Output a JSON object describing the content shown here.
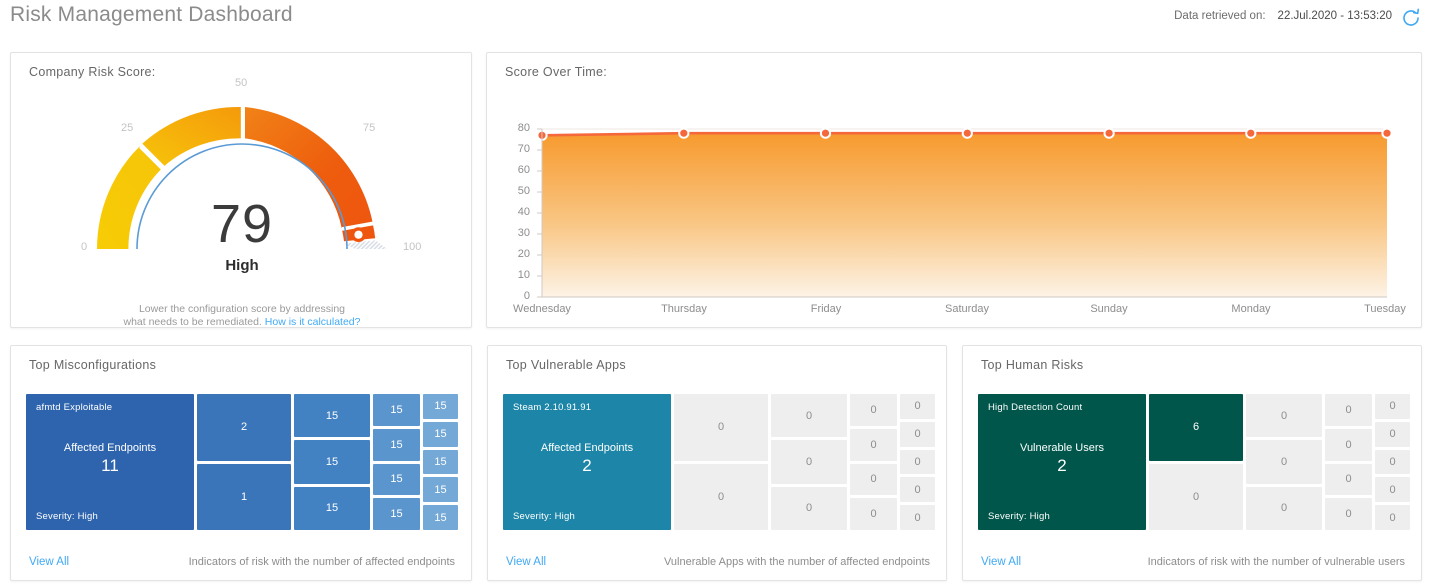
{
  "header": {
    "title": "Risk Management Dashboard",
    "retrieved_label": "Data retrieved on:",
    "retrieved_value": "22.Jul.2020 - 13:53:20",
    "refresh_icon": "refresh-icon",
    "accent": "#3fa9f5"
  },
  "risk_card": {
    "title": "Company Risk Score:",
    "value": "79",
    "level": "High",
    "tick_labels": [
      "0",
      "25",
      "50",
      "75",
      "100"
    ],
    "footer_line1": "Lower the configuration score by addressing",
    "footer_line2": "what needs to be remediated.",
    "footer_link": "How is it calculated?",
    "colors": {
      "low": "#f5c518",
      "mid": "#f59a0b",
      "high": "#ee5c0d",
      "empty": "#dfe3ea",
      "inner_arc": "#5b9bd5"
    }
  },
  "chart_data": {
    "type": "area",
    "title": "Score Over Time:",
    "categories": [
      "Wednesday",
      "Thursday",
      "Friday",
      "Saturday",
      "Sunday",
      "Monday",
      "Tuesday"
    ],
    "values": [
      77,
      78,
      78,
      78,
      78,
      78,
      78
    ],
    "ytick_labels": [
      "80",
      "70",
      "60",
      "50",
      "40",
      "30",
      "20",
      "10",
      "0"
    ],
    "ylim": [
      0,
      80
    ],
    "ylabel": "",
    "xlabel": "",
    "grid": true,
    "legend": "none",
    "line_color": "#f5683c",
    "fill_top": "#f7a440",
    "fill_bottom": "#fdf4e8",
    "marker_fill": "#f5683c",
    "marker_stroke": "#ffffff"
  },
  "misconfigurations": {
    "title": "Top Misconfigurations",
    "main_tile": {
      "name": "afmtd Exploitable",
      "caption": "Affected Endpoints",
      "value": "11",
      "severity": "Severity: High",
      "color": "#2e64ae"
    },
    "col2": [
      {
        "value": "2",
        "color": "#3a75ba"
      },
      {
        "value": "1",
        "color": "#3a75ba"
      }
    ],
    "col3": [
      {
        "value": "15",
        "color": "#4281c2"
      },
      {
        "value": "15",
        "color": "#4281c2"
      },
      {
        "value": "15",
        "color": "#4281c2"
      }
    ],
    "col4": [
      {
        "value": "15",
        "color": "#5b95cd"
      },
      {
        "value": "15",
        "color": "#5b95cd"
      },
      {
        "value": "15",
        "color": "#5b95cd"
      },
      {
        "value": "15",
        "color": "#5b95cd"
      }
    ],
    "col5": [
      {
        "value": "15",
        "color": "#74a8d7"
      },
      {
        "value": "15",
        "color": "#74a8d7"
      },
      {
        "value": "15",
        "color": "#74a8d7"
      },
      {
        "value": "15",
        "color": "#74a8d7"
      },
      {
        "value": "15",
        "color": "#74a8d7"
      }
    ],
    "view_all": "View All",
    "note": "Indicators of risk with the number of affected endpoints"
  },
  "vulnerable_apps": {
    "title": "Top Vulnerable Apps",
    "main_tile": {
      "name": "Steam 2.10.91.91",
      "caption": "Affected Endpoints",
      "value": "2",
      "severity": "Severity: High",
      "color": "#1d86a8"
    },
    "col2": [
      {
        "value": "0",
        "color": "#eeeeee"
      },
      {
        "value": "0",
        "color": "#eeeeee"
      }
    ],
    "col3": [
      {
        "value": "0",
        "color": "#eeeeee"
      },
      {
        "value": "0",
        "color": "#eeeeee"
      },
      {
        "value": "0",
        "color": "#eeeeee"
      }
    ],
    "col4": [
      {
        "value": "0",
        "color": "#eeeeee"
      },
      {
        "value": "0",
        "color": "#eeeeee"
      },
      {
        "value": "0",
        "color": "#eeeeee"
      },
      {
        "value": "0",
        "color": "#eeeeee"
      }
    ],
    "col5": [
      {
        "value": "0",
        "color": "#eeeeee"
      },
      {
        "value": "0",
        "color": "#eeeeee"
      },
      {
        "value": "0",
        "color": "#eeeeee"
      },
      {
        "value": "0",
        "color": "#eeeeee"
      },
      {
        "value": "0",
        "color": "#eeeeee"
      }
    ],
    "view_all": "View All",
    "note": "Vulnerable Apps with the number of affected endpoints"
  },
  "human_risks": {
    "title": "Top Human Risks",
    "main_tile": {
      "name": "High Detection Count",
      "caption": "Vulnerable Users",
      "value": "2",
      "severity": "Severity: High",
      "color": "#00564a"
    },
    "col2": [
      {
        "value": "6",
        "color": "#00564a"
      },
      {
        "value": "0",
        "color": "#eeeeee"
      }
    ],
    "col3": [
      {
        "value": "0",
        "color": "#eeeeee"
      },
      {
        "value": "0",
        "color": "#eeeeee"
      },
      {
        "value": "0",
        "color": "#eeeeee"
      }
    ],
    "col4": [
      {
        "value": "0",
        "color": "#eeeeee"
      },
      {
        "value": "0",
        "color": "#eeeeee"
      },
      {
        "value": "0",
        "color": "#eeeeee"
      },
      {
        "value": "0",
        "color": "#eeeeee"
      }
    ],
    "col5": [
      {
        "value": "0",
        "color": "#eeeeee"
      },
      {
        "value": "0",
        "color": "#eeeeee"
      },
      {
        "value": "0",
        "color": "#eeeeee"
      },
      {
        "value": "0",
        "color": "#eeeeee"
      },
      {
        "value": "0",
        "color": "#eeeeee"
      }
    ],
    "view_all": "View All",
    "note": "Indicators of risk with the number of vulnerable users"
  }
}
